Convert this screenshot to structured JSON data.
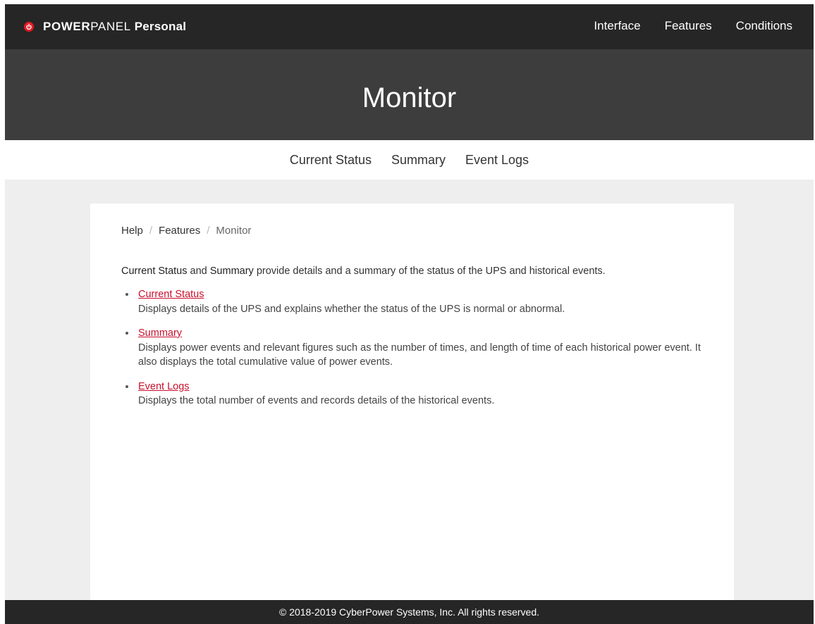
{
  "brand": {
    "power": "POWER",
    "panel": "PANEL",
    "personal": "Personal",
    "logo_icon": "power-icon",
    "logo_color": "#e31b23"
  },
  "topnav": [
    "Interface",
    "Features",
    "Conditions"
  ],
  "hero": {
    "title": "Monitor"
  },
  "subnav": [
    "Current Status",
    "Summary",
    "Event Logs"
  ],
  "breadcrumb": {
    "help": "Help",
    "features": "Features",
    "current": "Monitor",
    "separator": "/"
  },
  "intro": {
    "term1": "Current Status",
    "and": "and",
    "term2": "Summary",
    "rest": "provide details and a summary of the status of the UPS and historical events."
  },
  "items": [
    {
      "link": "Current Status",
      "desc": "Displays details of the UPS and explains whether the status of the UPS is normal or abnormal."
    },
    {
      "link": "Summary",
      "desc": "Displays power events and relevant figures such as the number of times, and length of time of each historical power event. It also displays the total cumulative value of power events."
    },
    {
      "link": "Event Logs",
      "desc": "Displays the total number of events and records details of the historical events."
    }
  ],
  "footer": {
    "text": "© 2018-2019 CyberPower Systems, Inc. All rights reserved."
  },
  "colors": {
    "link": "#c8102e",
    "topbar": "#262626",
    "hero": "#3d3d3d"
  }
}
